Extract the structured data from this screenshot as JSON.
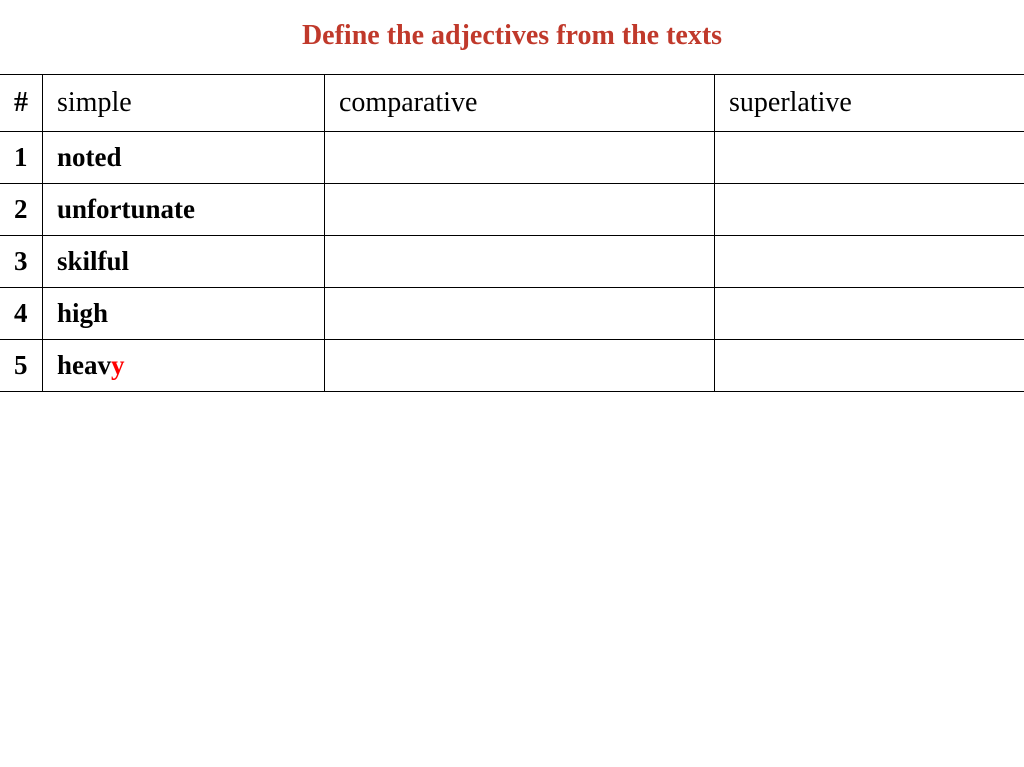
{
  "title": "Define the adjectives from the texts",
  "headers": {
    "num": "#",
    "simple": "simple",
    "comparative": "comparative",
    "superlative": "superlative"
  },
  "rows": [
    {
      "num": "1",
      "simple": "noted",
      "comparative": "",
      "superlative": ""
    },
    {
      "num": "2",
      "simple": "unfortunate",
      "comparative": "",
      "superlative": ""
    },
    {
      "num": "3",
      "simple": "skilful",
      "comparative": "",
      "superlative": ""
    },
    {
      "num": "4",
      "simple": "high",
      "comparative": "",
      "superlative": ""
    },
    {
      "num": "5",
      "simple_prefix": "heav",
      "simple_highlight": "y",
      "comparative": "",
      "superlative": ""
    }
  ]
}
